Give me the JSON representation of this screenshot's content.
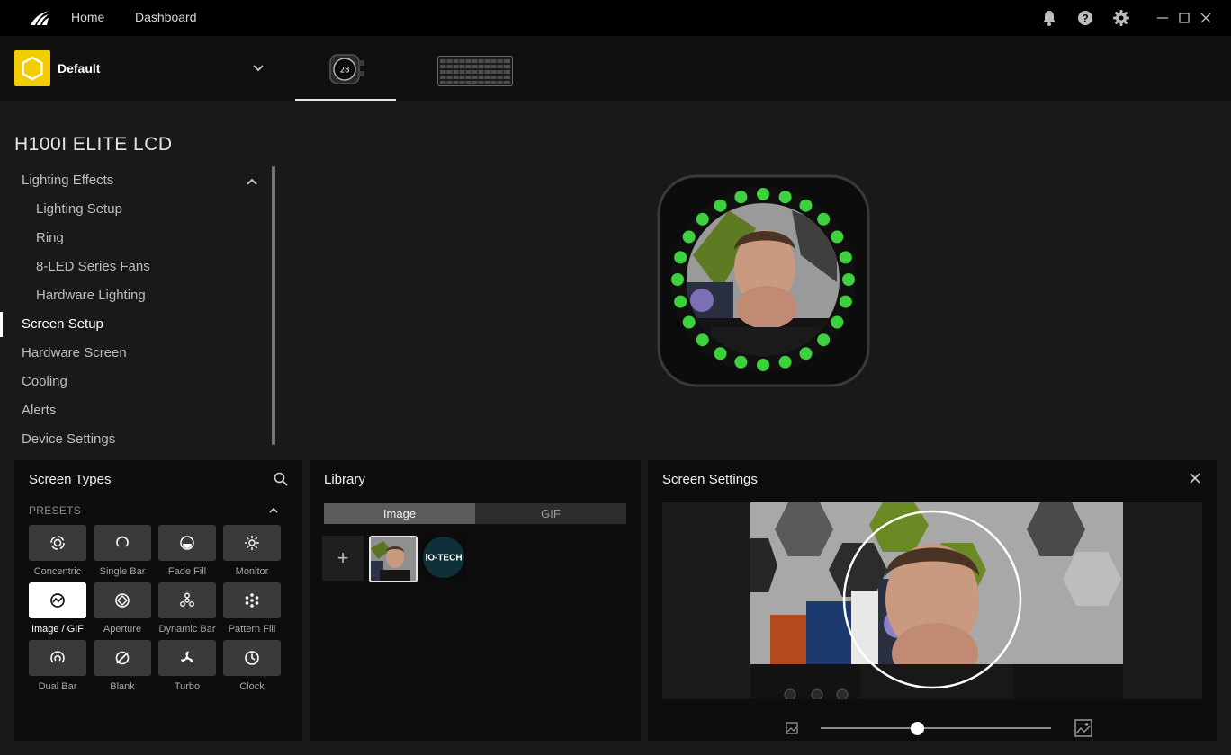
{
  "topbar": {
    "nav": [
      {
        "label": "Home"
      },
      {
        "label": "Dashboard"
      }
    ],
    "icons": [
      "bell-icon",
      "help-icon",
      "gear-icon"
    ],
    "window_controls": [
      "minimize-icon",
      "maximize-icon",
      "close-icon"
    ]
  },
  "profile": {
    "name": "Default",
    "icon_color": "#f2cd00"
  },
  "device_tabs": [
    {
      "name": "h100i-elite-lcd",
      "display": "28",
      "active": true
    },
    {
      "name": "keyboard",
      "active": false
    }
  ],
  "device": {
    "title": "H100I ELITE LCD"
  },
  "sidebar": {
    "items": [
      {
        "label": "Lighting Effects"
      },
      {
        "label": "Lighting Setup"
      },
      {
        "label": "Ring"
      },
      {
        "label": "8-LED Series Fans"
      },
      {
        "label": "Hardware Lighting"
      },
      {
        "label": "Screen Setup",
        "active": true
      },
      {
        "label": "Hardware Screen"
      },
      {
        "label": "Cooling"
      },
      {
        "label": "Alerts"
      },
      {
        "label": "Device Settings"
      }
    ]
  },
  "screen_types": {
    "title": "Screen Types",
    "presets_label": "PRESETS",
    "tiles": [
      {
        "label": "Concentric",
        "icon": "concentric-icon"
      },
      {
        "label": "Single Bar",
        "icon": "single-bar-icon"
      },
      {
        "label": "Fade Fill",
        "icon": "fade-fill-icon"
      },
      {
        "label": "Monitor",
        "icon": "monitor-icon"
      },
      {
        "label": "Image / GIF",
        "icon": "image-gif-icon",
        "selected": true
      },
      {
        "label": "Aperture",
        "icon": "aperture-icon"
      },
      {
        "label": "Dynamic Bar",
        "icon": "dynamic-bar-icon"
      },
      {
        "label": "Pattern Fill",
        "icon": "pattern-fill-icon"
      },
      {
        "label": "Dual Bar",
        "icon": "dual-bar-icon"
      },
      {
        "label": "Blank",
        "icon": "blank-icon"
      },
      {
        "label": "Turbo",
        "icon": "turbo-icon"
      },
      {
        "label": "Clock",
        "icon": "clock-icon"
      }
    ]
  },
  "library": {
    "title": "Library",
    "tabs": [
      {
        "label": "Image",
        "active": true
      },
      {
        "label": "GIF"
      }
    ],
    "add_label": "+",
    "thumbs": [
      {
        "name": "portrait"
      },
      {
        "name": "io-tech-logo",
        "text": "iO-TECH"
      }
    ]
  },
  "screen_settings": {
    "title": "Screen Settings",
    "zoom": 0.42
  },
  "colors": {
    "led_green": "#3dd23d",
    "accent_yellow": "#f2cd00"
  }
}
